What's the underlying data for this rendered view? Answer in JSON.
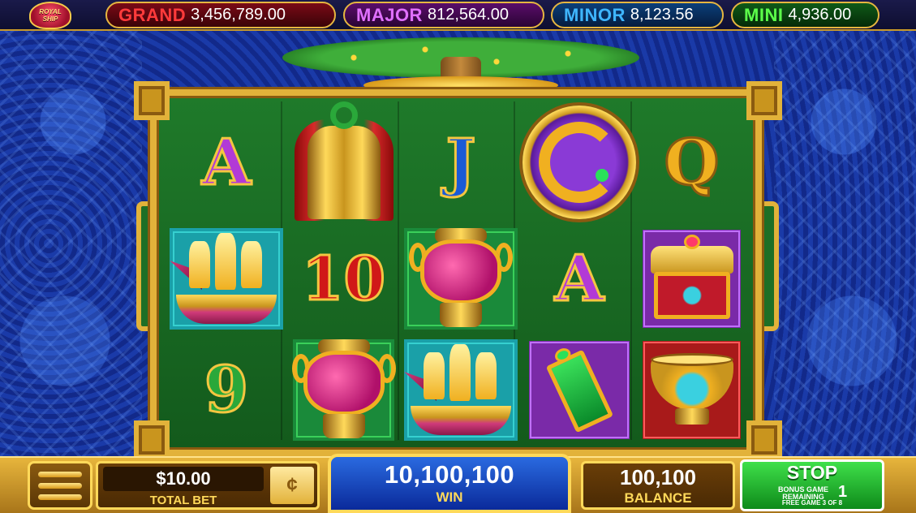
{
  "logo": {
    "line1": "ROYAL",
    "line2": "SHIP"
  },
  "jackpots": [
    {
      "label": "GRAND",
      "value": "3,456,789.00",
      "color": "#ff3b3b"
    },
    {
      "label": "MAJOR",
      "value": "812,564.00",
      "color": "#e070ff"
    },
    {
      "label": "MINOR",
      "value": "8,123.56",
      "color": "#3fb6ff"
    },
    {
      "label": "MINI",
      "value": "4,936.00",
      "color": "#5cff4a"
    }
  ],
  "reels": {
    "row1": [
      "A",
      "bell-icon",
      "J",
      "dragon-coin-icon",
      "Q"
    ],
    "row2": [
      "ship-icon",
      "10",
      "vase-icon",
      "A",
      "treasure-box-icon"
    ],
    "row3": [
      "9",
      "vase-icon",
      "ship-icon",
      "jade-tablet-icon",
      "bowl-icon"
    ],
    "letters": {
      "r1c1": "A",
      "r1c3": "J",
      "r1c5": "Q",
      "r2c2": "10",
      "r2c4": "A",
      "r3c1": "9"
    }
  },
  "bet": {
    "value": "$10.00",
    "label": "TOTAL BET",
    "currency_icon": "coin-icon"
  },
  "win": {
    "value": "10,100,100",
    "label": "WIN"
  },
  "balance": {
    "value": "100,100",
    "label": "BALANCE"
  },
  "stop": {
    "label": "STOP",
    "bonus_line1": "BONUS GAME",
    "bonus_line2": "REMAINING",
    "remaining": "1",
    "free_game": "FREE GAME 3 OF 8"
  },
  "colors": {
    "frame_gold": "#e2b23a",
    "reel_green": "#1f7a2a",
    "background_blue": "#1636a0",
    "win_blue": "#2a6ae0",
    "stop_green": "#3fe04a"
  }
}
